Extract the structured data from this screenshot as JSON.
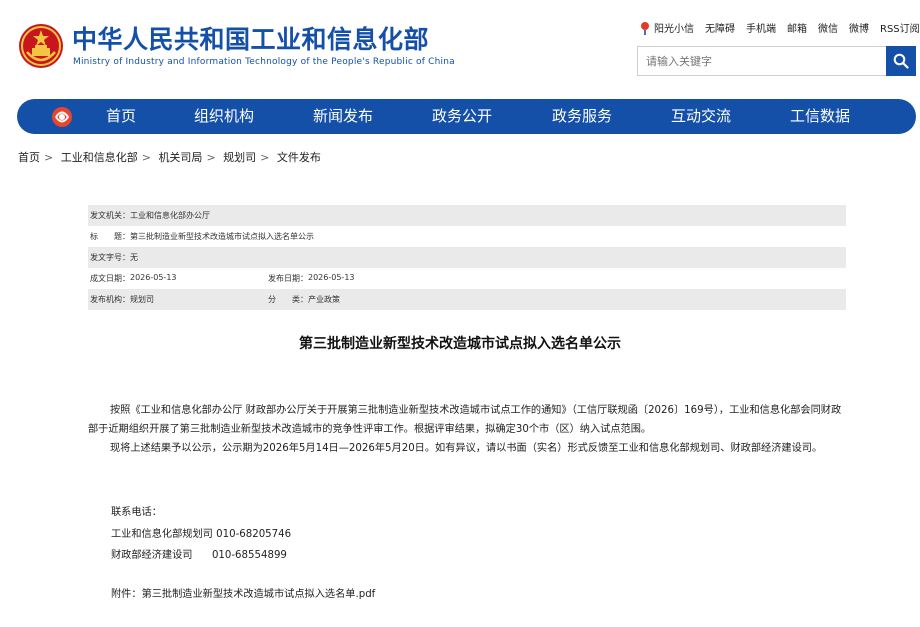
{
  "header": {
    "title_cn": "中华人民共和国工业和信息化部",
    "title_en": "Ministry of Industry and Information Technology of the People's Republic of China",
    "emblem_icon": "national-emblem-icon",
    "top_links": [
      "阳光小信",
      "无障碍",
      "手机端",
      "邮箱",
      "微信",
      "微博",
      "RSS订阅"
    ],
    "search_placeholder": "请输入关键字",
    "search_icon": "search-icon"
  },
  "colors": {
    "brand_blue": "#1550a8",
    "meta_shade": "#eaeaea"
  },
  "nav": {
    "logo_icon": "ministry-logo-icon",
    "items": [
      "首页",
      "组织机构",
      "新闻发布",
      "政务公开",
      "政务服务",
      "互动交流",
      "工信数据"
    ]
  },
  "breadcrumb": [
    "首页",
    "工业和信息化部",
    "机关司局",
    "规划司",
    "文件发布"
  ],
  "meta": {
    "issuer_label": "发文机关：",
    "issuer_value": "工业和信息化部办公厅",
    "title_label": "标　　题：",
    "title_value": "第三批制造业新型技术改造城市试点拟入选名单公示",
    "docno_label": "发文字号：",
    "docno_value": "无",
    "created_label": "成文日期：",
    "created_value": "2026-05-13",
    "published_label": "发布日期：",
    "published_value": "2026-05-13",
    "org_label": "发布机构：",
    "org_value": "规划司",
    "category_label": "分　　类：",
    "category_value": "产业政策"
  },
  "article": {
    "title": "第三批制造业新型技术改造城市试点拟入选名单公示",
    "paragraph1": "按照《工业和信息化部办公厅 财政部办公厅关于开展第三批制造业新型技术改造城市试点工作的通知》（工信厅联规函〔2026〕169号），工业和信息化部会同财政部于近期组织开展了第三批制造业新型技术改造城市的竞争性评审工作。根据评审结果，拟确定30个市（区）纳入试点范围。",
    "paragraph2": "现将上述结果予以公示，公示期为2026年5月14日—2026年5月20日。如有异议，请以书面（实名）形式反馈至工业和信息化部规划司、财政部经济建设司。",
    "contact_heading": "联系电话：",
    "contact1_name": "工业和信息化部规划司",
    "contact1_phone": "010-68205746",
    "contact2_name": "财政部经济建设司",
    "contact2_phone": "010-68554899",
    "attachment_label": "附件：",
    "attachment_file": "第三批制造业新型技术改造城市试点拟入选名单.pdf"
  }
}
